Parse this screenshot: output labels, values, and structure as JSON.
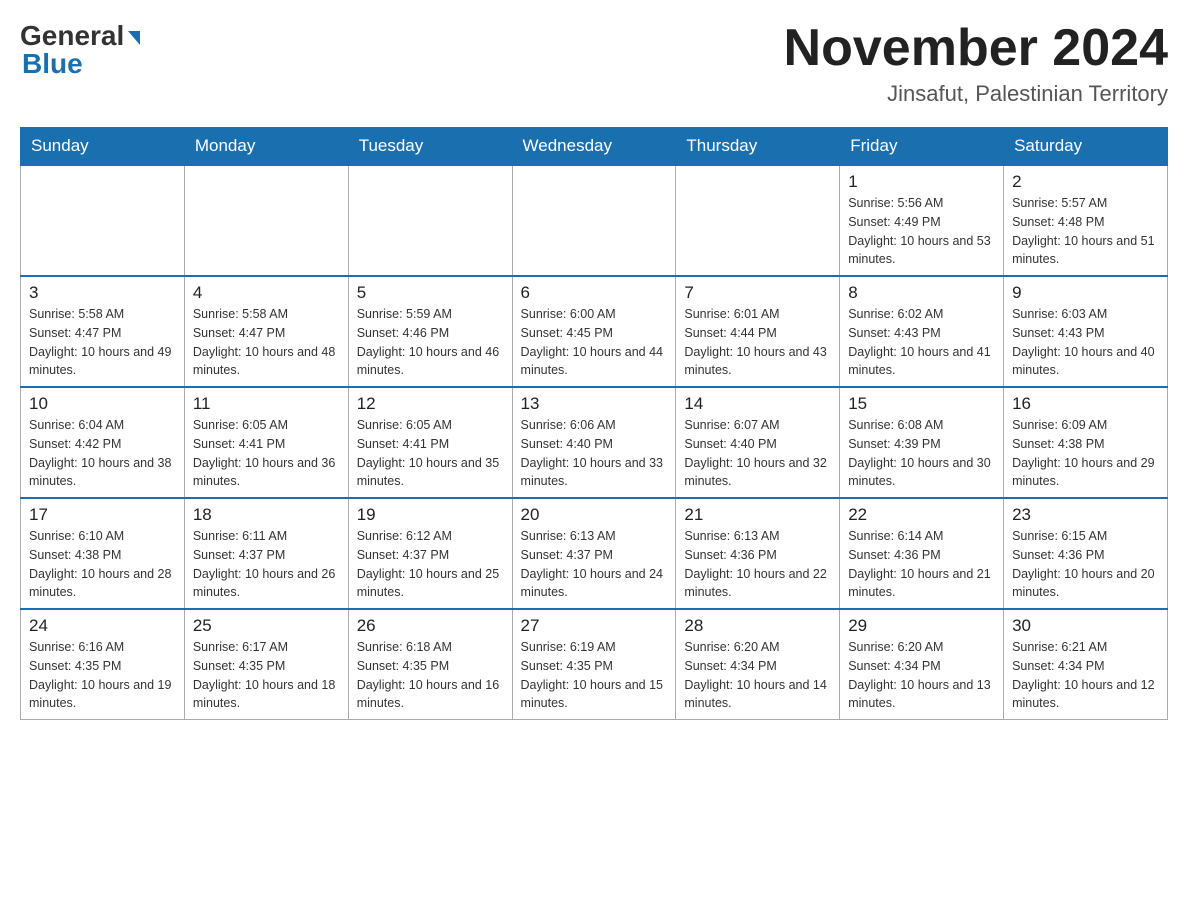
{
  "logo": {
    "general": "General",
    "blue": "Blue"
  },
  "header": {
    "month_year": "November 2024",
    "location": "Jinsafut, Palestinian Territory"
  },
  "weekdays": [
    "Sunday",
    "Monday",
    "Tuesday",
    "Wednesday",
    "Thursday",
    "Friday",
    "Saturday"
  ],
  "weeks": [
    [
      {
        "day": "",
        "sunrise": "",
        "sunset": "",
        "daylight": ""
      },
      {
        "day": "",
        "sunrise": "",
        "sunset": "",
        "daylight": ""
      },
      {
        "day": "",
        "sunrise": "",
        "sunset": "",
        "daylight": ""
      },
      {
        "day": "",
        "sunrise": "",
        "sunset": "",
        "daylight": ""
      },
      {
        "day": "",
        "sunrise": "",
        "sunset": "",
        "daylight": ""
      },
      {
        "day": "1",
        "sunrise": "Sunrise: 5:56 AM",
        "sunset": "Sunset: 4:49 PM",
        "daylight": "Daylight: 10 hours and 53 minutes."
      },
      {
        "day": "2",
        "sunrise": "Sunrise: 5:57 AM",
        "sunset": "Sunset: 4:48 PM",
        "daylight": "Daylight: 10 hours and 51 minutes."
      }
    ],
    [
      {
        "day": "3",
        "sunrise": "Sunrise: 5:58 AM",
        "sunset": "Sunset: 4:47 PM",
        "daylight": "Daylight: 10 hours and 49 minutes."
      },
      {
        "day": "4",
        "sunrise": "Sunrise: 5:58 AM",
        "sunset": "Sunset: 4:47 PM",
        "daylight": "Daylight: 10 hours and 48 minutes."
      },
      {
        "day": "5",
        "sunrise": "Sunrise: 5:59 AM",
        "sunset": "Sunset: 4:46 PM",
        "daylight": "Daylight: 10 hours and 46 minutes."
      },
      {
        "day": "6",
        "sunrise": "Sunrise: 6:00 AM",
        "sunset": "Sunset: 4:45 PM",
        "daylight": "Daylight: 10 hours and 44 minutes."
      },
      {
        "day": "7",
        "sunrise": "Sunrise: 6:01 AM",
        "sunset": "Sunset: 4:44 PM",
        "daylight": "Daylight: 10 hours and 43 minutes."
      },
      {
        "day": "8",
        "sunrise": "Sunrise: 6:02 AM",
        "sunset": "Sunset: 4:43 PM",
        "daylight": "Daylight: 10 hours and 41 minutes."
      },
      {
        "day": "9",
        "sunrise": "Sunrise: 6:03 AM",
        "sunset": "Sunset: 4:43 PM",
        "daylight": "Daylight: 10 hours and 40 minutes."
      }
    ],
    [
      {
        "day": "10",
        "sunrise": "Sunrise: 6:04 AM",
        "sunset": "Sunset: 4:42 PM",
        "daylight": "Daylight: 10 hours and 38 minutes."
      },
      {
        "day": "11",
        "sunrise": "Sunrise: 6:05 AM",
        "sunset": "Sunset: 4:41 PM",
        "daylight": "Daylight: 10 hours and 36 minutes."
      },
      {
        "day": "12",
        "sunrise": "Sunrise: 6:05 AM",
        "sunset": "Sunset: 4:41 PM",
        "daylight": "Daylight: 10 hours and 35 minutes."
      },
      {
        "day": "13",
        "sunrise": "Sunrise: 6:06 AM",
        "sunset": "Sunset: 4:40 PM",
        "daylight": "Daylight: 10 hours and 33 minutes."
      },
      {
        "day": "14",
        "sunrise": "Sunrise: 6:07 AM",
        "sunset": "Sunset: 4:40 PM",
        "daylight": "Daylight: 10 hours and 32 minutes."
      },
      {
        "day": "15",
        "sunrise": "Sunrise: 6:08 AM",
        "sunset": "Sunset: 4:39 PM",
        "daylight": "Daylight: 10 hours and 30 minutes."
      },
      {
        "day": "16",
        "sunrise": "Sunrise: 6:09 AM",
        "sunset": "Sunset: 4:38 PM",
        "daylight": "Daylight: 10 hours and 29 minutes."
      }
    ],
    [
      {
        "day": "17",
        "sunrise": "Sunrise: 6:10 AM",
        "sunset": "Sunset: 4:38 PM",
        "daylight": "Daylight: 10 hours and 28 minutes."
      },
      {
        "day": "18",
        "sunrise": "Sunrise: 6:11 AM",
        "sunset": "Sunset: 4:37 PM",
        "daylight": "Daylight: 10 hours and 26 minutes."
      },
      {
        "day": "19",
        "sunrise": "Sunrise: 6:12 AM",
        "sunset": "Sunset: 4:37 PM",
        "daylight": "Daylight: 10 hours and 25 minutes."
      },
      {
        "day": "20",
        "sunrise": "Sunrise: 6:13 AM",
        "sunset": "Sunset: 4:37 PM",
        "daylight": "Daylight: 10 hours and 24 minutes."
      },
      {
        "day": "21",
        "sunrise": "Sunrise: 6:13 AM",
        "sunset": "Sunset: 4:36 PM",
        "daylight": "Daylight: 10 hours and 22 minutes."
      },
      {
        "day": "22",
        "sunrise": "Sunrise: 6:14 AM",
        "sunset": "Sunset: 4:36 PM",
        "daylight": "Daylight: 10 hours and 21 minutes."
      },
      {
        "day": "23",
        "sunrise": "Sunrise: 6:15 AM",
        "sunset": "Sunset: 4:36 PM",
        "daylight": "Daylight: 10 hours and 20 minutes."
      }
    ],
    [
      {
        "day": "24",
        "sunrise": "Sunrise: 6:16 AM",
        "sunset": "Sunset: 4:35 PM",
        "daylight": "Daylight: 10 hours and 19 minutes."
      },
      {
        "day": "25",
        "sunrise": "Sunrise: 6:17 AM",
        "sunset": "Sunset: 4:35 PM",
        "daylight": "Daylight: 10 hours and 18 minutes."
      },
      {
        "day": "26",
        "sunrise": "Sunrise: 6:18 AM",
        "sunset": "Sunset: 4:35 PM",
        "daylight": "Daylight: 10 hours and 16 minutes."
      },
      {
        "day": "27",
        "sunrise": "Sunrise: 6:19 AM",
        "sunset": "Sunset: 4:35 PM",
        "daylight": "Daylight: 10 hours and 15 minutes."
      },
      {
        "day": "28",
        "sunrise": "Sunrise: 6:20 AM",
        "sunset": "Sunset: 4:34 PM",
        "daylight": "Daylight: 10 hours and 14 minutes."
      },
      {
        "day": "29",
        "sunrise": "Sunrise: 6:20 AM",
        "sunset": "Sunset: 4:34 PM",
        "daylight": "Daylight: 10 hours and 13 minutes."
      },
      {
        "day": "30",
        "sunrise": "Sunrise: 6:21 AM",
        "sunset": "Sunset: 4:34 PM",
        "daylight": "Daylight: 10 hours and 12 minutes."
      }
    ]
  ]
}
